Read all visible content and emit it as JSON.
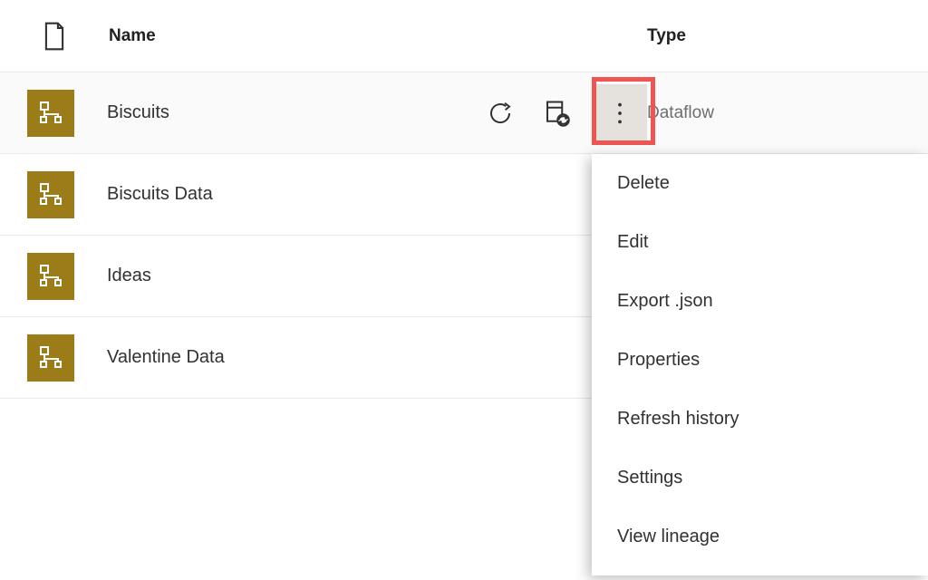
{
  "header": {
    "name_label": "Name",
    "type_label": "Type"
  },
  "items": [
    {
      "name": "Biscuits",
      "type": "Dataflow",
      "hovered": true
    },
    {
      "name": "Biscuits Data",
      "type": "",
      "hovered": false
    },
    {
      "name": "Ideas",
      "type": "",
      "hovered": false
    },
    {
      "name": "Valentine Data",
      "type": "",
      "hovered": false
    }
  ],
  "menu": {
    "items": [
      {
        "label": "Delete"
      },
      {
        "label": "Edit"
      },
      {
        "label": "Export .json"
      },
      {
        "label": "Properties"
      },
      {
        "label": "Refresh history"
      },
      {
        "label": "Settings"
      },
      {
        "label": "View lineage"
      }
    ]
  }
}
